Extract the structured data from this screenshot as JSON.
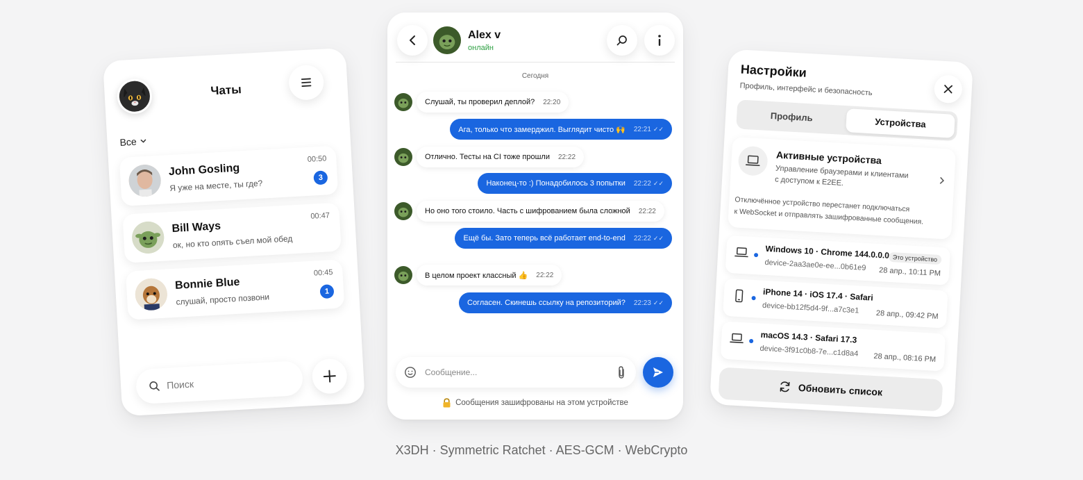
{
  "chats_panel": {
    "title": "Чаты",
    "filter_label": "Все",
    "search_placeholder": "Поиск",
    "chats": [
      {
        "name": "John Gosling",
        "preview": "Я уже на месте, ты где?",
        "time": "00:50",
        "unread": "3"
      },
      {
        "name": "Bill Ways",
        "preview": "ок, но кто опять съел мой обед",
        "time": "00:47",
        "unread": ""
      },
      {
        "name": "Bonnie Blue",
        "preview": "слушай, просто позвони",
        "time": "00:45",
        "unread": "1"
      }
    ]
  },
  "conversation": {
    "contact_name": "Alex v",
    "contact_status": "онлайн",
    "date_divider": "Сегодня",
    "messages": [
      {
        "dir": "in",
        "text": "Слушай, ты проверил деплой?",
        "time": "22:20"
      },
      {
        "dir": "out",
        "text": "Ага, только что замерджил. Выглядит чисто 🙌",
        "time": "22:21"
      },
      {
        "dir": "in",
        "text": "Отлично. Тесты на CI тоже прошли",
        "time": "22:22"
      },
      {
        "dir": "out",
        "text": "Наконец-то :) Понадобилось 3 попытки",
        "time": "22:22"
      },
      {
        "dir": "in",
        "text": "Но оно того стоило. Часть с шифрованием была сложной",
        "time": "22:22"
      },
      {
        "dir": "out",
        "text": "Ещё бы. Зато теперь всё работает end-to-end",
        "time": "22:22"
      },
      {
        "dir": "in",
        "text": "В целом проект классный 👍",
        "time": "22:22"
      },
      {
        "dir": "out",
        "text": "Согласен. Скинешь ссылку на репозиторий?",
        "time": "22:23"
      }
    ],
    "read_mark": "✓✓",
    "input_placeholder": "Сообщение...",
    "encryption_note": "Сообщения зашифрованы на этом устройстве"
  },
  "settings": {
    "title": "Настройки",
    "subtitle": "Профиль, интерфейс и безопасность",
    "tabs": [
      "Профиль",
      "Устройства"
    ],
    "active_tab": "Устройства",
    "active_devices": {
      "title": "Активные устройства",
      "description_line1": "Управление браузерами и клиентами",
      "description_line2": "с доступом к E2EE.",
      "note_line1": "Отключённое устройство перестанет подключаться",
      "note_line2": "к WebSocket и отправлять зашифрованные сообщения."
    },
    "devices": [
      {
        "type": "laptop",
        "name": "Windows 10 · Chrome 144.0.0.0",
        "id": "device-2aa3ae0e-ee...0b61e9",
        "date": "28 апр., 10:11 PM",
        "tag": "Это устройство"
      },
      {
        "type": "phone",
        "name": "iPhone 14 · iOS 17.4 · Safari",
        "id": "device-bb12f5d4-9f...a7c3e1",
        "date": "28 апр., 09:42 PM",
        "tag": ""
      },
      {
        "type": "laptop",
        "name": "macOS 14.3 · Safari 17.3",
        "id": "device-3f91c0b8-7e...c1d8a4",
        "date": "28 апр., 08:16 PM",
        "tag": ""
      }
    ],
    "refresh_label": "Обновить список"
  },
  "footer": "X3DH · Symmetric Ratchet · AES-GCM · WebCrypto",
  "colors": {
    "accent": "#1a66e0",
    "online": "#2ea043",
    "background": "#f4f4f5"
  }
}
